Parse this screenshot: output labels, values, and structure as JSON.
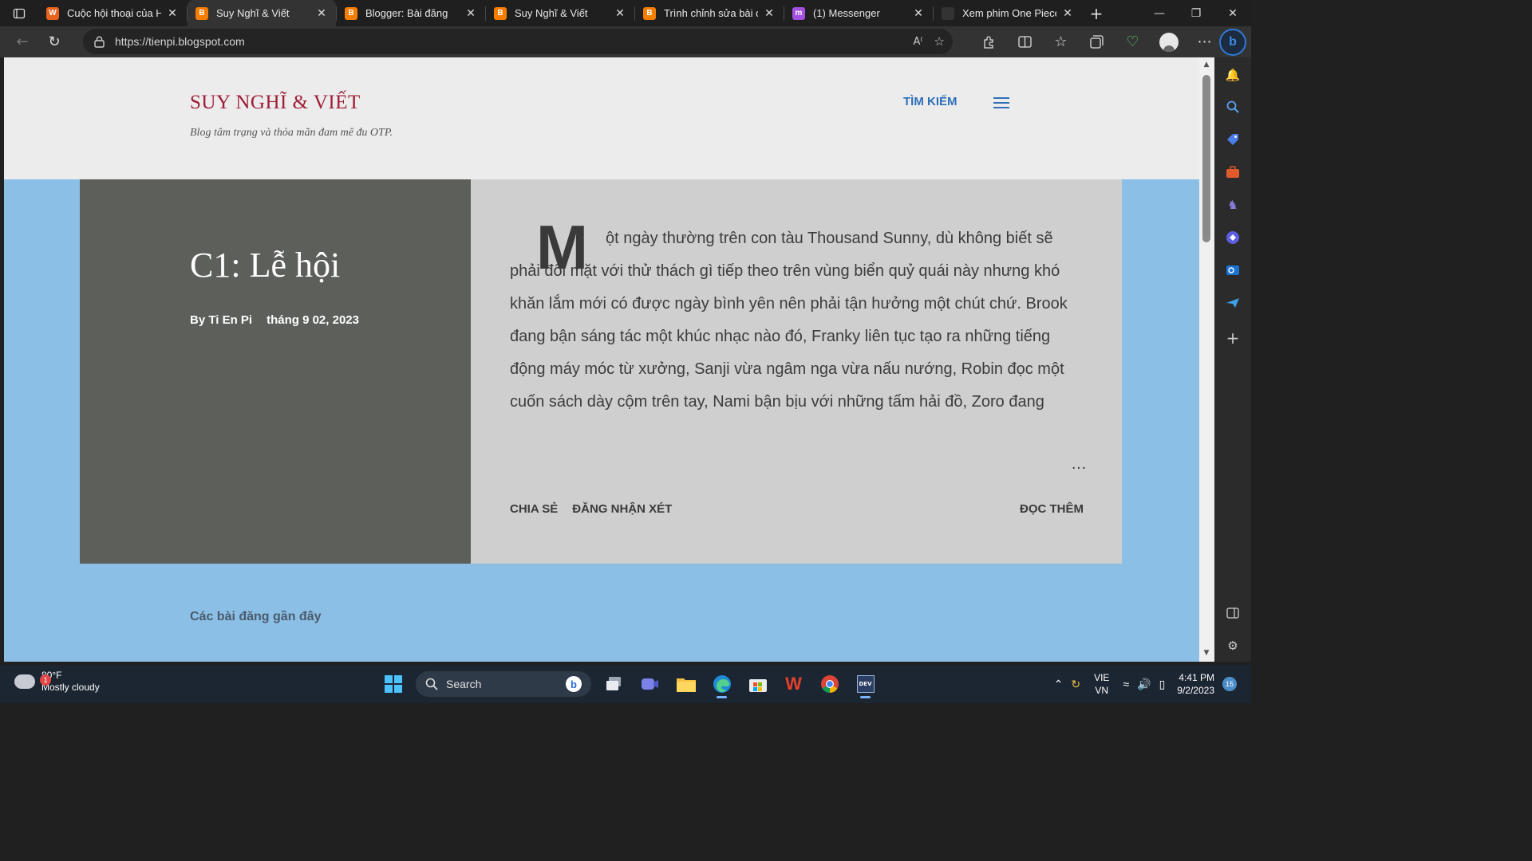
{
  "tabs": [
    {
      "title": "Cuộc hội thoại của He",
      "favicon_color": "#e8641e",
      "favicon_letter": "W",
      "active": false
    },
    {
      "title": "Suy Nghĩ & Viết",
      "favicon_color": "#f57d00",
      "favicon_letter": "B",
      "active": true
    },
    {
      "title": "Blogger: Bài đăng",
      "favicon_color": "#f57d00",
      "favicon_letter": "B",
      "active": false
    },
    {
      "title": "Suy Nghĩ & Viết",
      "favicon_color": "#f57d00",
      "favicon_letter": "B",
      "active": false
    },
    {
      "title": "Trình chỉnh sửa bài đă",
      "favicon_color": "#f57d00",
      "favicon_letter": "B",
      "active": false
    },
    {
      "title": "(1) Messenger",
      "favicon_color": "#a34fe0",
      "favicon_letter": "m",
      "active": false
    },
    {
      "title": "Xem phim One Piece ",
      "favicon_color": "#333333",
      "favicon_letter": "",
      "active": false
    }
  ],
  "address_bar": {
    "url": "https://tienpi.blogspot.com"
  },
  "blog": {
    "title": "SUY NGHĨ & VIẾT",
    "description": "Blog tâm trạng và thỏa mãn đam mê đu OTP.",
    "search_label": "TÌM KIẾM"
  },
  "post": {
    "title": "C1: Lễ hội",
    "author": "By Ti En Pi",
    "date": "tháng 9 02, 2023",
    "dropcap": "M",
    "snippet": "ột ngày thường trên con tàu Thousand Sunny, dù không biết sẽ phải đối mặt với thử thách gì tiếp theo trên vùng biển quỷ quái này nhưng khó khăn lắm mới có được ngày bình yên nên phải tận hưởng một chút chứ. Brook đang bận sáng tác một khúc nhạc nào đó, Franky liên tục tạo ra những tiếng động máy móc từ xưởng, Sanji vừa ngâm nga vừa nấu nướng, Robin đọc một cuốn sách dày cộm trên tay, Nami bận bịu với những tấm hải đồ, Zoro đang luyện tập trên phòng quan sát. Chắc chắn sẽ là một ngày thư giãn nếu trên tàu không có bộ ba Luffy, Usopp, Chopper. \"Đến và bắt tớ đi này Chopper.\" Luffy vừ",
    "ellipsis": "…",
    "share_label": "CHIA SẺ",
    "comment_label": "ĐĂNG NHẬN XÉT",
    "read_more_label": "ĐỌC THÊM"
  },
  "recent_posts_heading": "Các bài đăng gần đây",
  "taskbar": {
    "weather_temp": "80°F",
    "weather_desc": "Mostly cloudy",
    "weather_badge": "1",
    "search_label": "Search",
    "lang_line1": "VIE",
    "lang_line2": "VN",
    "time": "4:41 PM",
    "date": "9/2/2023",
    "notification_count": "15"
  },
  "colors": {
    "accent_blue": "#2e6fb8",
    "blog_title": "#a01c36",
    "page_bg": "#8bbfe6"
  }
}
